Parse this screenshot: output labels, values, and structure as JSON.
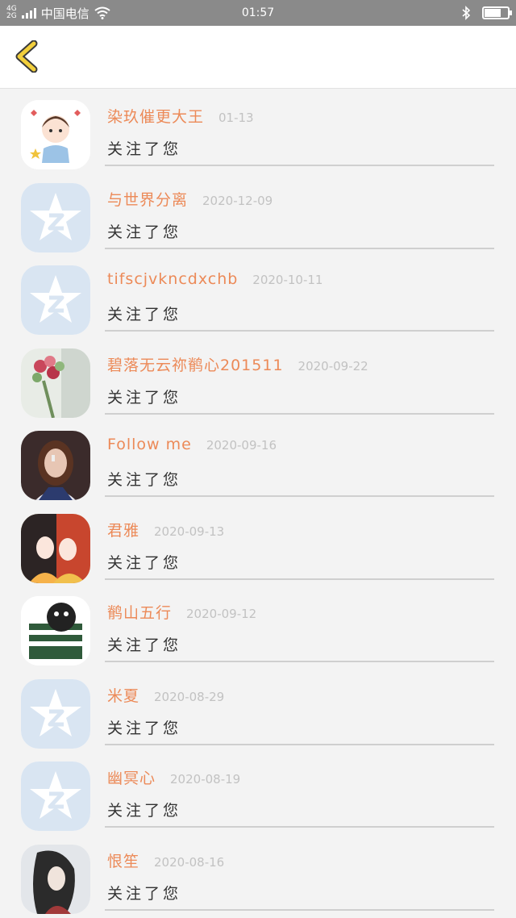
{
  "status_bar": {
    "carrier": "中国电信",
    "network_top": "4G",
    "network_bottom": "2G",
    "time": "01:57",
    "battery_level": 0.7
  },
  "header": {
    "back_icon": "chevron-left-icon"
  },
  "notifications": [
    {
      "name": "染玖催更大王",
      "date": "01-13",
      "action": "关注了您",
      "avatar": "cartoon-girl"
    },
    {
      "name": "与世界分离",
      "date": "2020-12-09",
      "action": "关注了您",
      "avatar": "default-qq-star"
    },
    {
      "name": "tifscjvkncdxchb",
      "date": "2020-10-11",
      "action": "关注了您",
      "avatar": "default-qq-star"
    },
    {
      "name": "碧落无云祢鹡心201511",
      "date": "2020-09-22",
      "action": "关注了您",
      "avatar": "flowers-photo"
    },
    {
      "name": "Follow me",
      "date": "2020-09-16",
      "action": "关注了您",
      "avatar": "girl-portrait"
    },
    {
      "name": "君雅",
      "date": "2020-09-13",
      "action": "关注了您",
      "avatar": "anime-girls"
    },
    {
      "name": "鹡山五行",
      "date": "2020-09-12",
      "action": "关注了您",
      "avatar": "meme-character"
    },
    {
      "name": "米夏",
      "date": "2020-08-29",
      "action": "关注了您",
      "avatar": "default-qq-star"
    },
    {
      "name": "幽冥心",
      "date": "2020-08-19",
      "action": "关注了您",
      "avatar": "default-qq-star"
    },
    {
      "name": "恨笙",
      "date": "2020-08-16",
      "action": "关注了您",
      "avatar": "ink-illustration"
    }
  ],
  "colors": {
    "name": "#ec8a58",
    "date": "#c2c2c2",
    "back_arrow": "#f2cf3c"
  }
}
